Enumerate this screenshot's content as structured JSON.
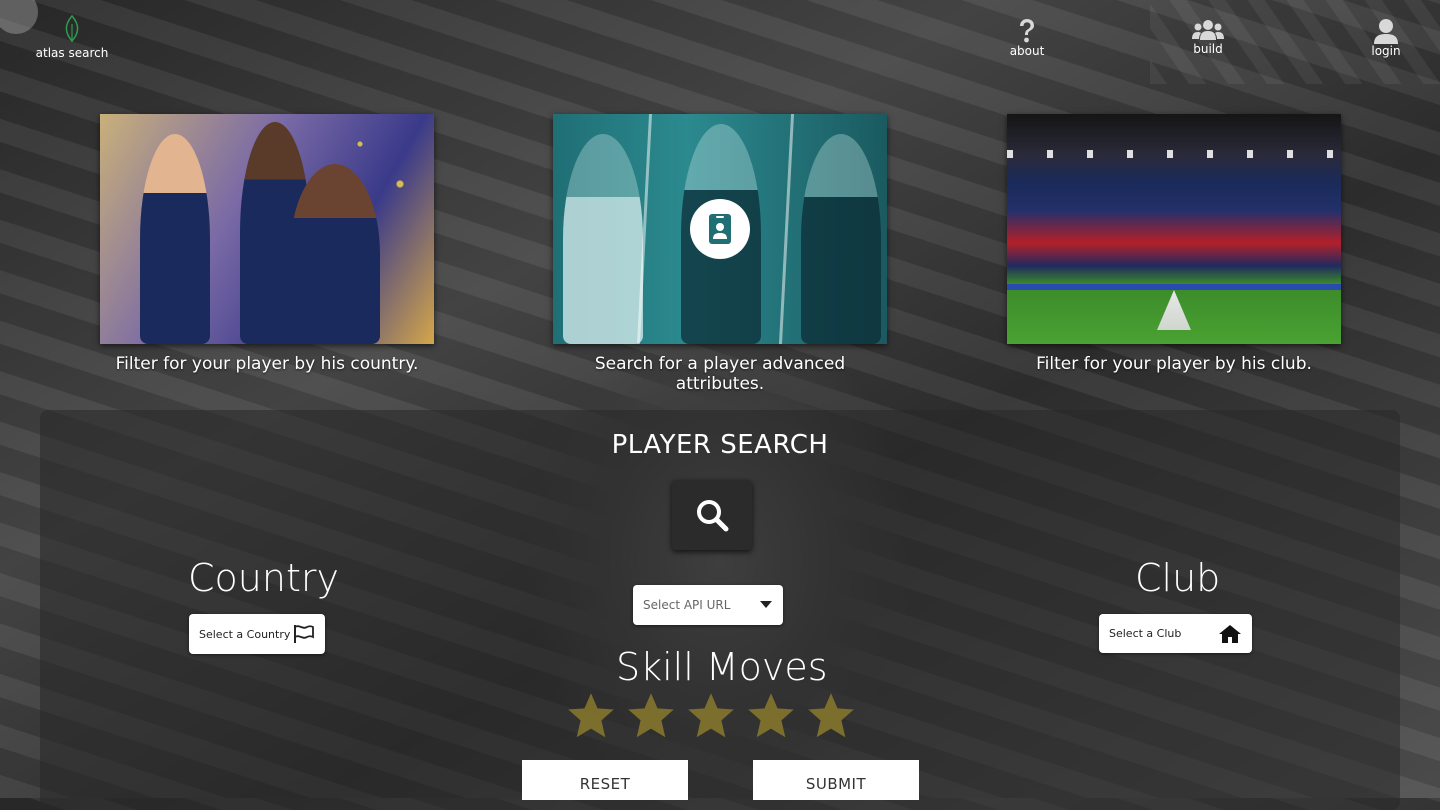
{
  "header": {
    "logo_label": "atlas search",
    "nav": [
      {
        "label": "about",
        "icon": "question-icon"
      },
      {
        "label": "build",
        "icon": "users-icon"
      },
      {
        "label": "login",
        "icon": "user-icon"
      }
    ]
  },
  "cards": [
    {
      "caption": "Filter for your player by his country."
    },
    {
      "caption": "Search for a player advanced attributes."
    },
    {
      "caption": "Filter for your player by his club."
    }
  ],
  "player_search": {
    "title": "PLAYER SEARCH",
    "country_title": "Country",
    "country_select": "Select a Country",
    "api_select": "Select API URL",
    "club_title": "Club",
    "club_select": "Select a Club",
    "skill_title": "Skill Moves",
    "skill_stars": 5,
    "reset_label": "RESET",
    "submit_label": "SUBMIT"
  },
  "colors": {
    "logo_green": "#2e9b4e",
    "star_fill": "#8a7a2e",
    "teal_overlay": "#1f6f75"
  }
}
